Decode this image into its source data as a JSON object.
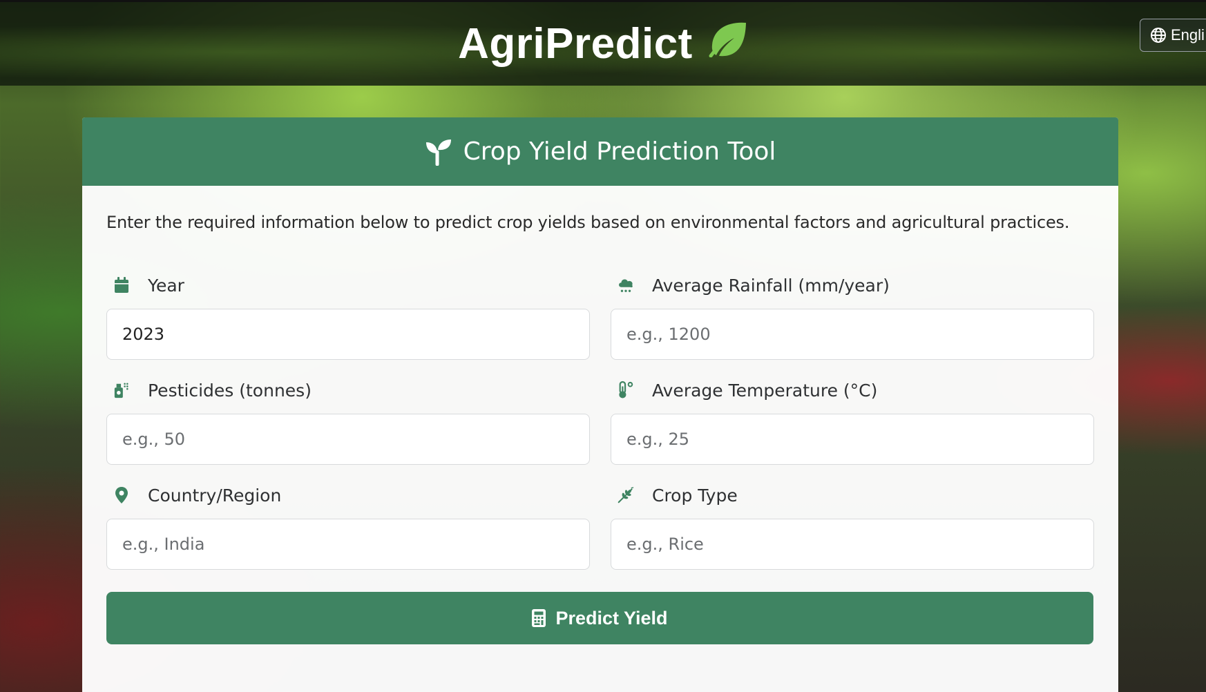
{
  "header": {
    "brand": "AgriPredict",
    "language_label": "Engli"
  },
  "card": {
    "title": "Crop Yield Prediction Tool",
    "intro": "Enter the required information below to predict crop yields based on environmental factors and agricultural practices."
  },
  "fields": {
    "year": {
      "label": "Year",
      "value": "2023",
      "placeholder": ""
    },
    "rainfall": {
      "label": "Average Rainfall (mm/year)",
      "value": "",
      "placeholder": "e.g., 1200"
    },
    "pesticides": {
      "label": "Pesticides (tonnes)",
      "value": "",
      "placeholder": "e.g., 50"
    },
    "temperature": {
      "label": "Average Temperature (°C)",
      "value": "",
      "placeholder": "e.g., 25"
    },
    "country": {
      "label": "Country/Region",
      "value": "",
      "placeholder": "e.g., India"
    },
    "crop": {
      "label": "Crop Type",
      "value": "",
      "placeholder": "e.g., Rice"
    }
  },
  "actions": {
    "predict_label": "Predict Yield"
  },
  "icons": {
    "brand": "leaf-icon",
    "language": "globe-icon",
    "title": "seedling-icon",
    "year": "calendar-icon",
    "rainfall": "cloud-rain-icon",
    "pesticides": "spray-can-icon",
    "temperature": "thermometer-icon",
    "country": "map-pin-icon",
    "crop": "wheat-icon",
    "predict": "calculator-icon"
  },
  "colors": {
    "primary": "#3f8462",
    "icon": "#3f8462",
    "card_background": "#ffffff"
  }
}
